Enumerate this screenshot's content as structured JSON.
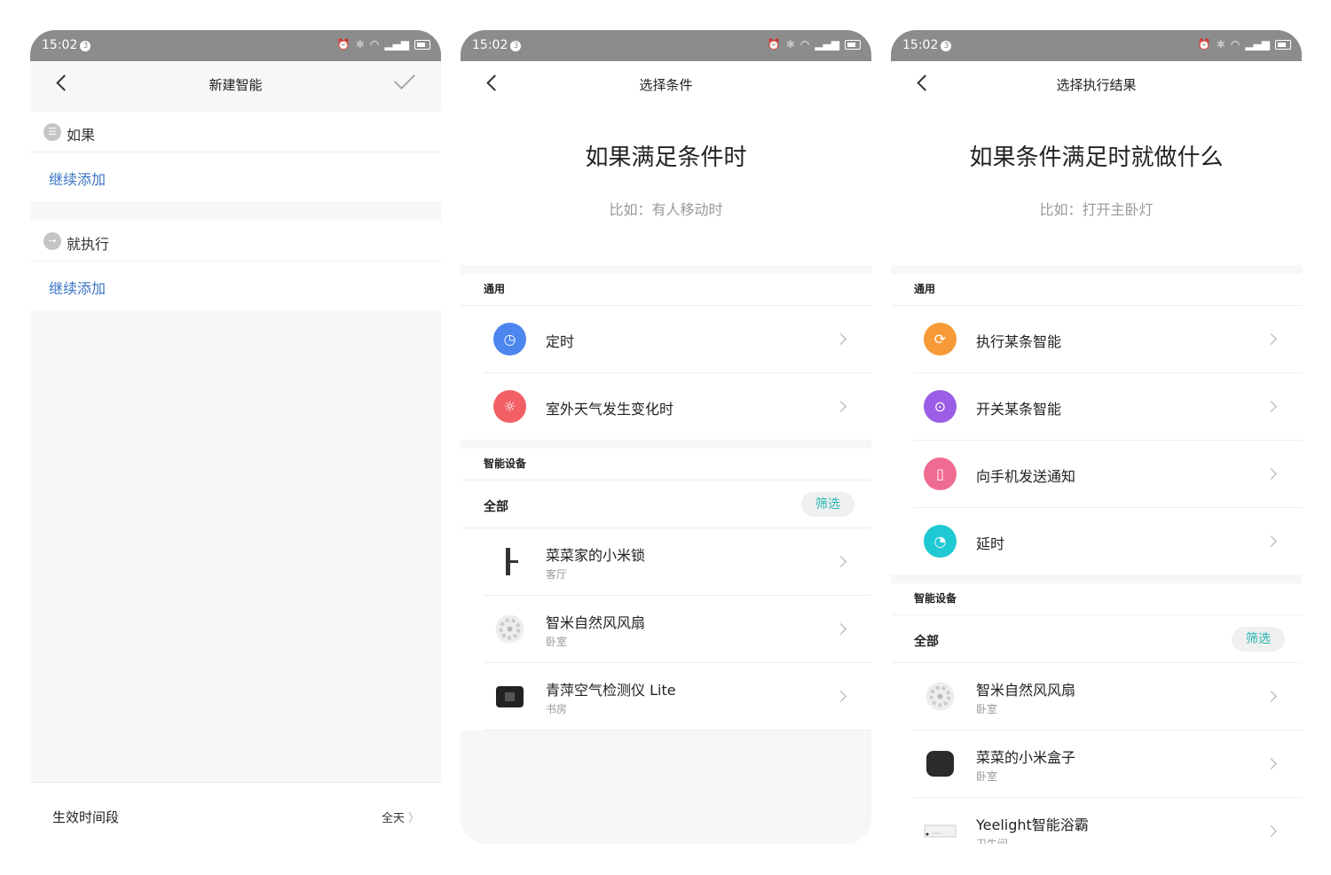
{
  "status": {
    "time": "15:02",
    "badge": "3"
  },
  "screen1": {
    "title": "新建智能",
    "if_label": "如果",
    "if_add": "继续添加",
    "then_label": "就执行",
    "then_add": "继续添加",
    "footer_label": "生效时间段",
    "footer_value": "全天"
  },
  "screen2": {
    "title": "选择条件",
    "heading": "如果满足条件时",
    "hint": "比如：有人移动时",
    "general_label": "通用",
    "general_items": [
      {
        "label": "定时",
        "icon": "clock-icon",
        "color": "#4c86ee"
      },
      {
        "label": "室外天气发生变化时",
        "icon": "weather-icon",
        "color": "#f26065"
      }
    ],
    "devices_label": "智能设备",
    "all_label": "全部",
    "filter_label": "筛选",
    "devices": [
      {
        "name": "菜菜家的小米锁",
        "room": "客厅",
        "icon": "door-lock-icon"
      },
      {
        "name": "智米自然风风扇",
        "room": "卧室",
        "icon": "fan-icon"
      },
      {
        "name": "青萍空气检测仪 Lite",
        "room": "书房",
        "icon": "air-monitor-icon"
      }
    ]
  },
  "screen3": {
    "title": "选择执行结果",
    "heading": "如果条件满足时就做什么",
    "hint": "比如：打开主卧灯",
    "general_label": "通用",
    "general_items": [
      {
        "label": "执行某条智能",
        "icon": "run-scene-icon",
        "color": "#f59a37"
      },
      {
        "label": "开关某条智能",
        "icon": "toggle-scene-icon",
        "color": "#9b5de5"
      },
      {
        "label": "向手机发送通知",
        "icon": "phone-notify-icon",
        "color": "#f06b92"
      },
      {
        "label": "延时",
        "icon": "delay-icon",
        "color": "#1fc9d3"
      }
    ],
    "devices_label": "智能设备",
    "all_label": "全部",
    "filter_label": "筛选",
    "devices": [
      {
        "name": "智米自然风风扇",
        "room": "卧室",
        "icon": "fan-icon"
      },
      {
        "name": "菜菜的小米盒子",
        "room": "卧室",
        "icon": "tv-box-icon"
      },
      {
        "name": "Yeelight智能浴霸",
        "room": "卫生间",
        "icon": "bath-heater-icon"
      }
    ]
  }
}
